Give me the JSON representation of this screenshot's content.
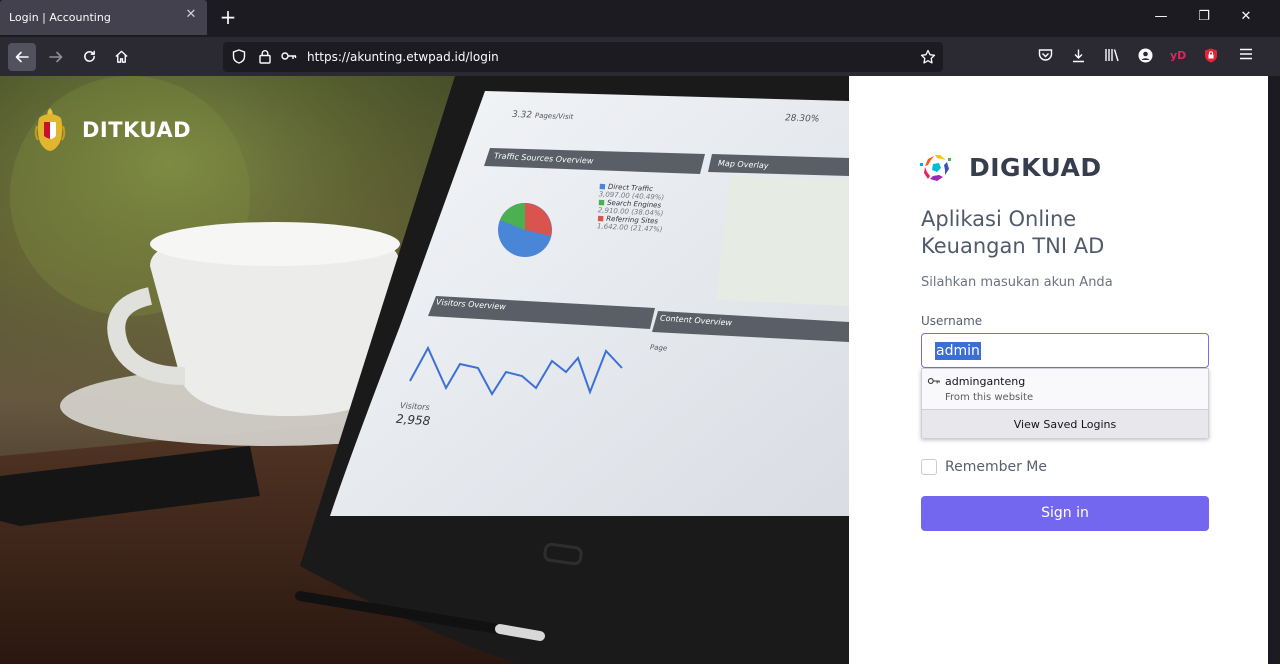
{
  "browser": {
    "tab_title": "Login | Accounting",
    "tab_close": "✕",
    "new_tab": "+",
    "url": "https://akunting.etwpad.id/login",
    "window_controls": [
      "—",
      "❐",
      "✕"
    ],
    "toolbar_icons": [
      "pocket-icon",
      "download-icon",
      "library-icon",
      "account-icon",
      "yd-extension-icon",
      "ublock-icon",
      "menu-icon"
    ],
    "yd_label": "yD"
  },
  "hero": {
    "brand": "DITKUAD",
    "tablet": {
      "pages_per_visit": "3.32",
      "pages_per_visit_label": "Pages/Visit",
      "bounce": "28.30%",
      "traffic_panel_title": "Traffic Sources Overview",
      "map_panel_title": "Map Overlay",
      "legend": [
        {
          "label": "Direct Traffic",
          "detail": "3,097.00 (40.49%)",
          "color": "#4a86d8"
        },
        {
          "label": "Search Engines",
          "detail": "2,910.00 (38.04%)",
          "color": "#4caf50"
        },
        {
          "label": "Referring Sites",
          "detail": "1,642.00 (21.47%)",
          "color": "#d9534f"
        }
      ],
      "visitors_panel_title": "Visitors Overview",
      "content_panel_title": "Content Overview",
      "page_col": "Page",
      "visitors_label": "Visitors",
      "visitors_value": "2,958"
    }
  },
  "login": {
    "brand": "DIGKUAD",
    "headline_line1": "Aplikasi Online",
    "headline_line2": "Keuangan TNI AD",
    "subtitle": "Silahkan masukan akun Anda",
    "username_label": "Username",
    "username_value": "admin",
    "autocomplete": {
      "username": "adminganteng",
      "source": "From this website",
      "footer": "View Saved Logins"
    },
    "remember_label": "Remember Me",
    "signin_label": "Sign in",
    "accent_color": "#7367f0"
  }
}
